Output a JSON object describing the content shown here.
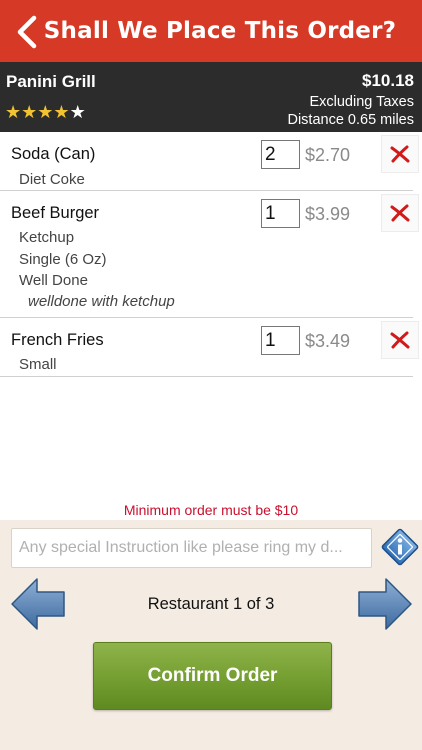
{
  "header": {
    "title": "Shall We Place This Order?",
    "back_icon": "chevron-left-icon",
    "bg_color": "#d63a26"
  },
  "restaurant": {
    "name": "Panini Grill",
    "rating": 4,
    "rating_max": 5,
    "total": "$10.18",
    "tax_note": "Excluding Taxes",
    "distance": "Distance 0.65 miles"
  },
  "items": [
    {
      "name": "Soda (Can)",
      "qty": "2",
      "price": "$2.70",
      "options": [
        "Diet Coke"
      ],
      "note": ""
    },
    {
      "name": "Beef Burger",
      "qty": "1",
      "price": "$3.99",
      "options": [
        "Ketchup",
        "Single (6 Oz)",
        "Well Done"
      ],
      "note": "welldone  with ketchup"
    },
    {
      "name": "French Fries",
      "qty": "1",
      "price": "$3.49",
      "options": [
        "Small"
      ],
      "note": ""
    }
  ],
  "min_order_message": "Minimum order must be $10",
  "instructions": {
    "placeholder": "Any special Instruction like please ring my d...",
    "value": ""
  },
  "pager": {
    "label": "Restaurant 1 of 3"
  },
  "confirm_button": {
    "label": "Confirm Order",
    "color": "#76a032"
  },
  "icons": {
    "delete": "x-icon",
    "info": "info-icon",
    "prev": "arrow-left-icon",
    "next": "arrow-right-icon"
  }
}
